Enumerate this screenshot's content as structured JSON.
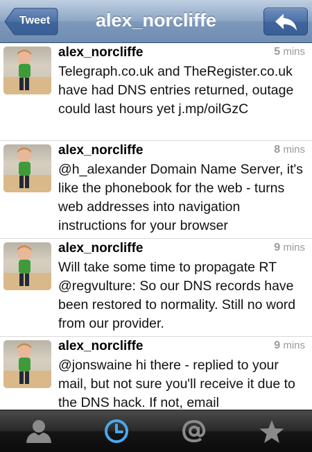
{
  "nav": {
    "title": "alex_norcliffe",
    "back_label": "Tweet",
    "reply_icon": "reply-arrow-icon"
  },
  "tweets": [
    {
      "name": "alex_norcliffe",
      "time_value": "5",
      "time_unit": "mins",
      "text": "Telegraph.co.uk and TheRegister.co.uk have had DNS entries returned, outage could last hours yet j.mp/oilGzC"
    },
    {
      "name": "alex_norcliffe",
      "time_value": "8",
      "time_unit": "mins",
      "text": "@h_alexander Domain Name Server, it's like the phonebook for the web - turns web addresses into navigation instructions for your browser"
    },
    {
      "name": "alex_norcliffe",
      "time_value": "9",
      "time_unit": "mins",
      "text": "Will take some time to propagate RT @regvulture: So our DNS records have been restored to normality. Still no word from our provider."
    },
    {
      "name": "alex_norcliffe",
      "time_value": "9",
      "time_unit": "mins",
      "text": "@jonswaine hi there - replied to your mail, but not sure you'll receive it due to the DNS hack. If not, email"
    }
  ],
  "tabbar": {
    "tabs": [
      {
        "icon": "person-icon",
        "selected": false
      },
      {
        "icon": "clock-icon",
        "selected": true
      },
      {
        "icon": "at-sign-icon",
        "selected": false
      },
      {
        "icon": "star-icon",
        "selected": false
      }
    ],
    "accent": "#4aa8ec"
  }
}
